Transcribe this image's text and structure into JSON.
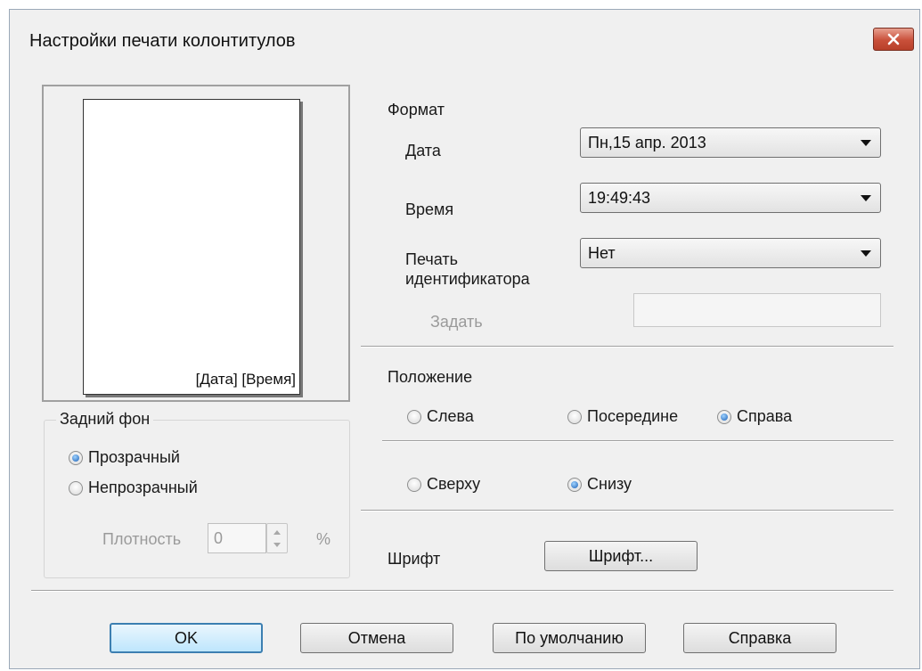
{
  "window": {
    "title": "Настройки печати колонтитулов"
  },
  "preview": {
    "footer_text": "[Дата] [Время]"
  },
  "background": {
    "group_title": "Задний фон",
    "options": [
      {
        "label": "Прозрачный",
        "selected": true
      },
      {
        "label": "Непрозрачный",
        "selected": false
      }
    ],
    "density_label": "Плотность",
    "density_value": "0",
    "density_unit": "%"
  },
  "format": {
    "title": "Формат",
    "date_label": "Дата",
    "date_value": "Пн,15 апр. 2013",
    "time_label": "Время",
    "time_value": "19:49:43",
    "id_label_line1": "Печать",
    "id_label_line2": "идентификатора",
    "id_value": "Нет",
    "set_label": "Задать",
    "set_value": ""
  },
  "position": {
    "title": "Положение",
    "horizontal": [
      {
        "label": "Слева",
        "selected": false
      },
      {
        "label": "Посередине",
        "selected": false
      },
      {
        "label": "Справа",
        "selected": true
      }
    ],
    "vertical": [
      {
        "label": "Сверху",
        "selected": false
      },
      {
        "label": "Снизу",
        "selected": true
      }
    ]
  },
  "font": {
    "label": "Шрифт",
    "button_label": "Шрифт..."
  },
  "buttons": {
    "ok": "OK",
    "cancel": "Отмена",
    "default": "По умолчанию",
    "help": "Справка"
  },
  "colors": {
    "close_button": "#c9503a",
    "default_button_border": "#3c7fb1",
    "radio_selected": "#1b5fb5"
  }
}
